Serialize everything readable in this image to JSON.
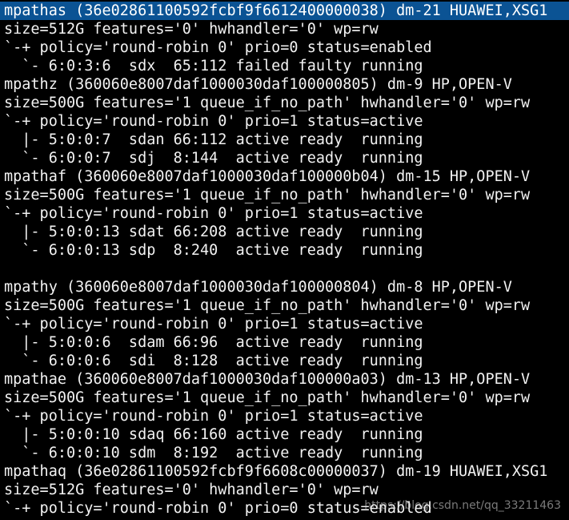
{
  "colors": {
    "background": "#000000",
    "text": "#f2f2f2",
    "selection": "#0b5394"
  },
  "terminal": {
    "lines": [
      "mpathas (36e02861100592fcbf9f6612400000038) dm-21 HUAWEI,XSG1",
      "size=512G features='0' hwhandler='0' wp=rw",
      "`-+ policy='round-robin 0' prio=0 status=enabled",
      "  `- 6:0:3:6  sdx  65:112 failed faulty running",
      "mpathz (360060e8007daf1000030daf100000805) dm-9 HP,OPEN-V",
      "size=500G features='1 queue_if_no_path' hwhandler='0' wp=rw",
      "`-+ policy='round-robin 0' prio=1 status=active",
      "  |- 5:0:0:7  sdan 66:112 active ready  running",
      "  `- 6:0:0:7  sdj  8:144  active ready  running",
      "mpathaf (360060e8007daf1000030daf100000b04) dm-15 HP,OPEN-V",
      "size=500G features='1 queue_if_no_path' hwhandler='0' wp=rw",
      "`-+ policy='round-robin 0' prio=1 status=active",
      "  |- 5:0:0:13 sdat 66:208 active ready  running",
      "  `- 6:0:0:13 sdp  8:240  active ready  running",
      "",
      "mpathy (360060e8007daf1000030daf100000804) dm-8 HP,OPEN-V",
      "size=500G features='1 queue_if_no_path' hwhandler='0' wp=rw",
      "`-+ policy='round-robin 0' prio=1 status=active",
      "  |- 5:0:0:6  sdam 66:96  active ready  running",
      "  `- 6:0:0:6  sdi  8:128  active ready  running",
      "mpathae (360060e8007daf1000030daf100000a03) dm-13 HP,OPEN-V",
      "size=500G features='1 queue_if_no_path' hwhandler='0' wp=rw",
      "`-+ policy='round-robin 0' prio=1 status=active",
      "  |- 5:0:0:10 sdaq 66:160 active ready  running",
      "  `- 6:0:0:10 sdm  8:192  active ready  running",
      "mpathaq (36e02861100592fcbf9f6608c00000037) dm-19 HUAWEI,XSG1",
      "size=512G features='0' hwhandler='0' wp=rw",
      "`-+ policy='round-robin 0' prio=0 status=enabled"
    ]
  },
  "watermark": "https://blog.csdn.net/qq_33211463"
}
